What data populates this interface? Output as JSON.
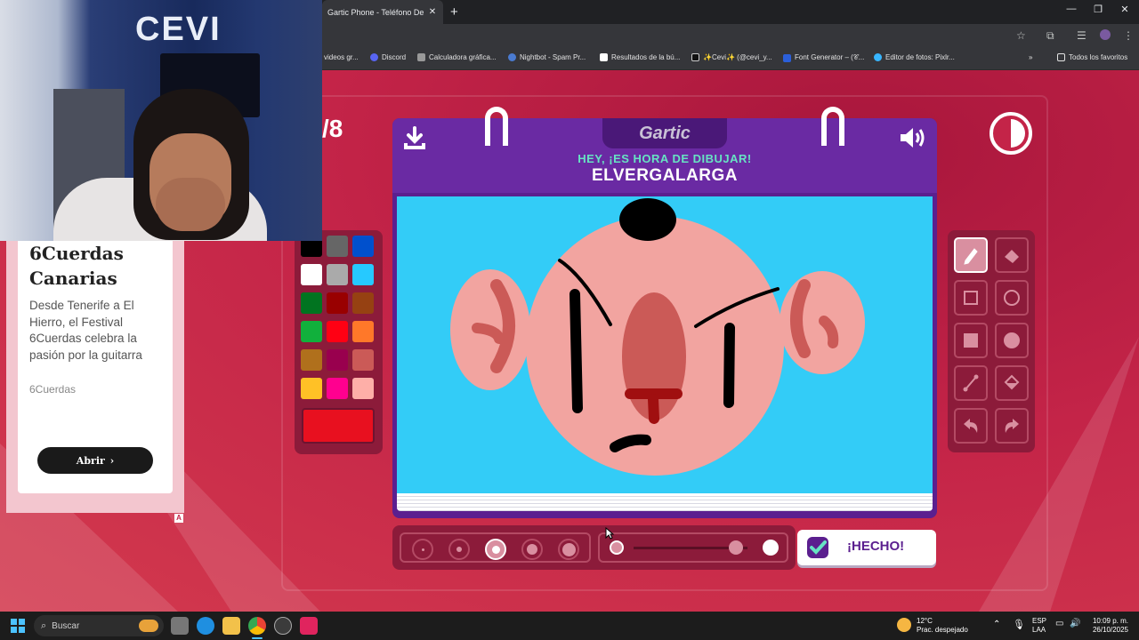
{
  "browser": {
    "tab_title": "Gartic Phone - Teléfono Desco",
    "bookmarks": [
      {
        "label": "videos gr...",
        "color": "#888888"
      },
      {
        "label": "Discord",
        "color": "#5865f2"
      },
      {
        "label": "Calculadora gráfica...",
        "color": "#aaaaaa"
      },
      {
        "label": "Nightbot - Spam Pr...",
        "color": "#4a7bd1"
      },
      {
        "label": "Resultados de la bú...",
        "color": "#ffffff"
      },
      {
        "label": "✨Cevi✨ (@cevi_y...",
        "color": "#111111"
      },
      {
        "label": "Font Generator – (𝒞...",
        "color": "#2b5fd9"
      },
      {
        "label": "Editor de fotos: Pixlr...",
        "color": "#38b6ff"
      }
    ],
    "all_bookmarks": "Todos los favoritos"
  },
  "webcam": {
    "sign_text": "CEVI"
  },
  "ad": {
    "title": "6Cuerdas Canarias",
    "body": "Desde Tenerife a El Hierro, el Festival 6Cuerdas celebra la pasión por la guitarra",
    "source": "6Cuerdas",
    "button": "Abrir",
    "badge": "A"
  },
  "game": {
    "round": "/8",
    "logo": "Gartic",
    "subtitle": "HEY, ¡ES HORA DE DIBUJAR!",
    "word": "ELVERGALARGA",
    "done_button": "¡HECHO!",
    "timer_remaining_fraction": 0.5,
    "palette": [
      "#000000",
      "#666666",
      "#0050cd",
      "#ffffff",
      "#aaaaaa",
      "#26c9ff",
      "#017420",
      "#990000",
      "#964112",
      "#11b03c",
      "#ff0013",
      "#ff7829",
      "#b0701c",
      "#99004e",
      "#cb5a57",
      "#ffc126",
      "#ff008f",
      "#feafa8"
    ],
    "selected_color": "#e8101f",
    "brush_sizes": [
      1,
      2,
      3,
      4,
      5
    ],
    "selected_brush_size": 3,
    "opacity_level": 0.9,
    "tools": [
      "pencil-icon",
      "eraser-icon",
      "square-icon",
      "circle-icon",
      "filled-square-icon",
      "filled-circle-icon",
      "line-icon",
      "bucket-icon",
      "undo-icon",
      "redo-icon"
    ]
  },
  "taskbar": {
    "search_label": "Buscar",
    "weather_temp": "12°C",
    "weather_desc": "Prac. despejado",
    "lang": "ESP",
    "lang2": "LAA",
    "time": "10:09 p. m.",
    "date": "26/10/2025"
  }
}
